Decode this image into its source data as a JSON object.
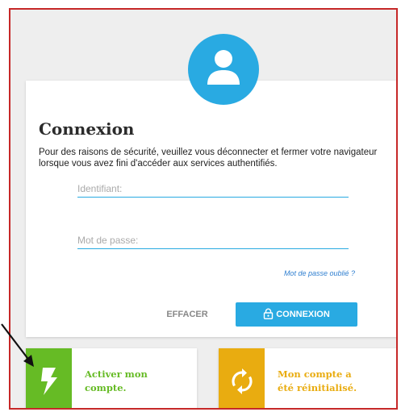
{
  "login": {
    "title": "Connexion",
    "description": "Pour des raisons de sécurité, veuillez vous déconnecter et fermer votre navigateur lorsque vous avez fini d'accéder aux services authentifiés.",
    "username_placeholder": "Identifiant:",
    "password_placeholder": "Mot de passe:",
    "forgot_password": "Mot de passe oublié ?",
    "clear_label": "EFFACER",
    "login_label": "CONNEXION"
  },
  "tiles": [
    {
      "label": "Activer mon compte.",
      "icon": "lightning-icon",
      "color": "#66bb25"
    },
    {
      "label": "Mon compte a été réinitialisé.",
      "icon": "sync-icon",
      "color": "#e9ac10"
    }
  ],
  "colors": {
    "accent": "#29aae2",
    "frame_border": "#c62828",
    "background": "#eeeeee"
  }
}
